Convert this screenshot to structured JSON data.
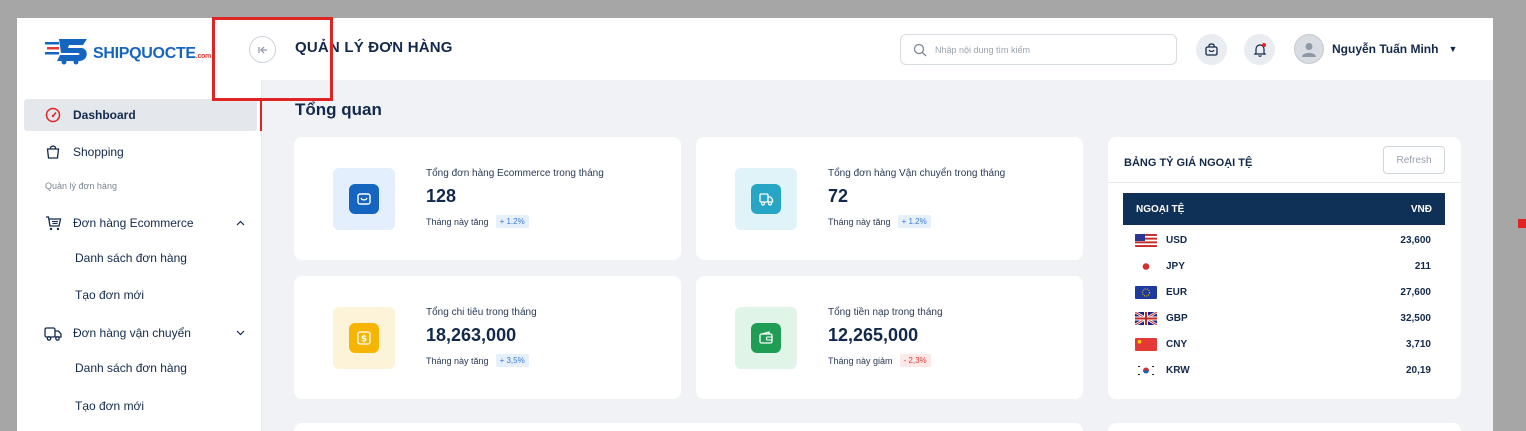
{
  "brand": {
    "name": "SHIPQUOCTE",
    "suffix": ".com"
  },
  "header": {
    "title": "QUẢN LÝ ĐƠN HÀNG",
    "search_placeholder": "Nhập nội dung tìm kiếm",
    "user_name": "Nguyễn Tuấn Minh"
  },
  "sidebar": {
    "dashboard": "Dashboard",
    "shopping": "Shopping",
    "section": "Quản lý đơn hàng",
    "ecommerce": "Đơn hàng Ecommerce",
    "ecommerce_list": "Danh sách đơn hàng",
    "ecommerce_new": "Tạo đơn mới",
    "shipping": "Đơn hàng vận chuyển",
    "shipping_list": "Danh sách đơn hàng",
    "shipping_new": "Tạo đơn mới"
  },
  "main": {
    "section_title": "Tổng quan",
    "stats": [
      {
        "label": "Tổng đơn hàng Ecommerce trong tháng",
        "value": "128",
        "trend_text": "Tháng này tăng",
        "trend": "+ 1.2%"
      },
      {
        "label": "Tổng đơn hàng Vận chuyển trong tháng",
        "value": "72",
        "trend_text": "Tháng này tăng",
        "trend": "+ 1.2%"
      },
      {
        "label": "Tổng chi tiêu trong tháng",
        "value": "18,263,000",
        "trend_text": "Tháng này tăng",
        "trend": "+ 3,5%"
      },
      {
        "label": "Tổng tiền nạp trong tháng",
        "value": "12,265,000",
        "trend_text": "Tháng này giảm",
        "trend": "- 2,3%"
      }
    ]
  },
  "fx": {
    "title": "BẢNG TỶ GIÁ NGOẠI TỆ",
    "refresh": "Refresh",
    "col_currency": "NGOẠI TỆ",
    "col_rate": "VNĐ",
    "rows": [
      {
        "code": "USD",
        "rate": "23,600"
      },
      {
        "code": "JPY",
        "rate": "211"
      },
      {
        "code": "EUR",
        "rate": "27,600"
      },
      {
        "code": "GBP",
        "rate": "32,500"
      },
      {
        "code": "CNY",
        "rate": "3,710"
      },
      {
        "code": "KRW",
        "rate": "20,19"
      }
    ]
  },
  "colors": {
    "accent": "#e02424",
    "navy": "#13294b",
    "ecommerce": "#1565c0",
    "shipping": "#26a5c4",
    "spend": "#f6b500",
    "topup": "#1f9d55"
  }
}
